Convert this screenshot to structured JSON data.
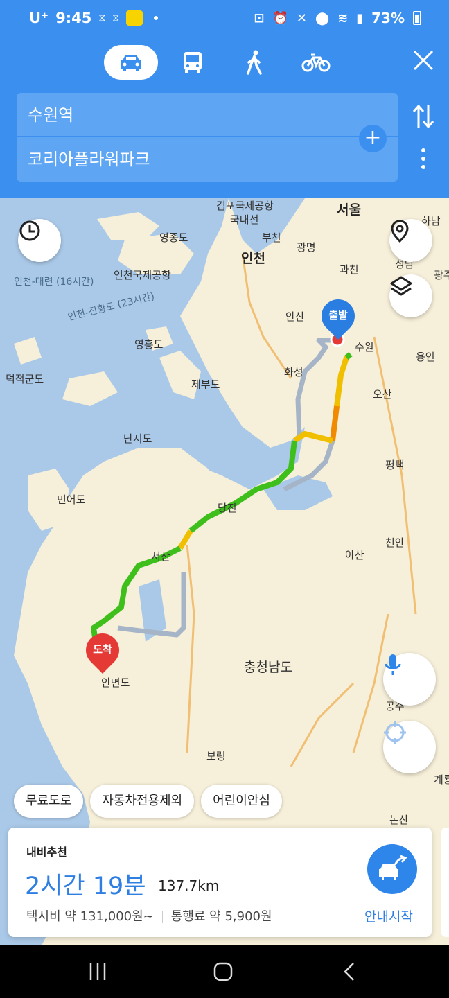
{
  "status_bar": {
    "carrier": "U⁺",
    "time": "9:45",
    "battery": "73%"
  },
  "modes": [
    {
      "icon": "car-icon",
      "active": true
    },
    {
      "icon": "bus-icon",
      "active": false
    },
    {
      "icon": "walk-icon",
      "active": false
    },
    {
      "icon": "bike-icon",
      "active": false
    }
  ],
  "route_inputs": {
    "origin": "수원역",
    "destination": "코리아플라워파크"
  },
  "map": {
    "labels": {
      "gimpo": "김포국제공항",
      "seoul": "서울",
      "hanam": "하남",
      "gungnaeseon": "국내선",
      "bucheon": "부천",
      "gwangmyeong": "광명",
      "yeongjongdo": "영종도",
      "incheon": "인천",
      "gwacheon": "과천",
      "seongnam": "성남",
      "gwangju": "광주",
      "incheon_airport": "인천국제공항",
      "ferry1": "인천-대련 (16시간)",
      "ferry2": "인천-진황도 (23시간)",
      "ansan": "안산",
      "suwon": "수원",
      "yongin": "용인",
      "yeongheungdo": "영흥도",
      "hwaseong": "화성",
      "deokjeokgundo": "덕적군도",
      "jebudo": "제부도",
      "osan": "오산",
      "nanjido": "난지도",
      "pyeongtaek": "평택",
      "mineodo": "민어도",
      "dangjin": "당진",
      "seosan": "서산",
      "asan": "아산",
      "cheonan": "천안",
      "chungnam": "충청남도",
      "anmyeondo": "안면도",
      "gongju": "공주",
      "boryeong": "보령",
      "nonsan": "논산",
      "gyeryong": "계룡"
    },
    "start_label": "출발",
    "end_label": "도착"
  },
  "filters": [
    "무료도로",
    "자동차전용제외",
    "어린이안심"
  ],
  "route_card": {
    "recommend_label": "내비추천",
    "duration": "2시간 19분",
    "distance": "137.7km",
    "taxi_fare": "택시비 약 131,000원~",
    "toll": "통행료 약 5,900원",
    "start_button": "안내시작"
  },
  "colors": {
    "header_blue": "#3a8fef",
    "route_green": "#3fbf1c",
    "route_yellow": "#f0c000",
    "route_orange": "#f08a00",
    "alt_route_gray": "#a5b4c6",
    "start_pin": "#2a7de1",
    "end_pin": "#e53935",
    "sea": "#aac9e8",
    "land": "#f6efd9"
  }
}
